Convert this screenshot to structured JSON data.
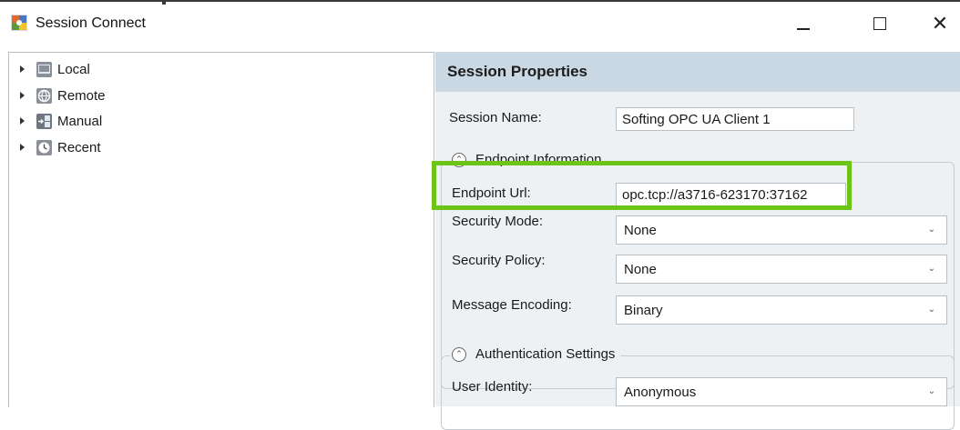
{
  "window": {
    "title": "Session Connect",
    "minimize_glyph": "",
    "close_glyph": "✕"
  },
  "tree": {
    "items": [
      {
        "label": "Local",
        "icon": "computer-icon"
      },
      {
        "label": "Remote",
        "icon": "remote-icon"
      },
      {
        "label": "Manual",
        "icon": "manual-icon"
      },
      {
        "label": "Recent",
        "icon": "clock-icon"
      }
    ]
  },
  "session_properties": {
    "header": "Session Properties",
    "session_name_label": "Session Name:",
    "session_name_value": "Softing OPC UA Client 1",
    "endpoint_group": {
      "title": "Endpoint Information",
      "endpoint_url_label": "Endpoint Url:",
      "endpoint_url_value": "opc.tcp://a3716-623170:37162",
      "security_mode_label": "Security Mode:",
      "security_mode_value": "None",
      "security_policy_label": "Security Policy:",
      "security_policy_value": "None",
      "message_encoding_label": "Message Encoding:",
      "message_encoding_value": "Binary"
    },
    "auth_group": {
      "title": "Authentication Settings",
      "user_identity_label": "User Identity:",
      "user_identity_value": "Anonymous"
    }
  },
  "colors": {
    "highlight": "#6cc417",
    "header_bg": "#c9d8e2",
    "panel_bg": "#eef1f4"
  }
}
